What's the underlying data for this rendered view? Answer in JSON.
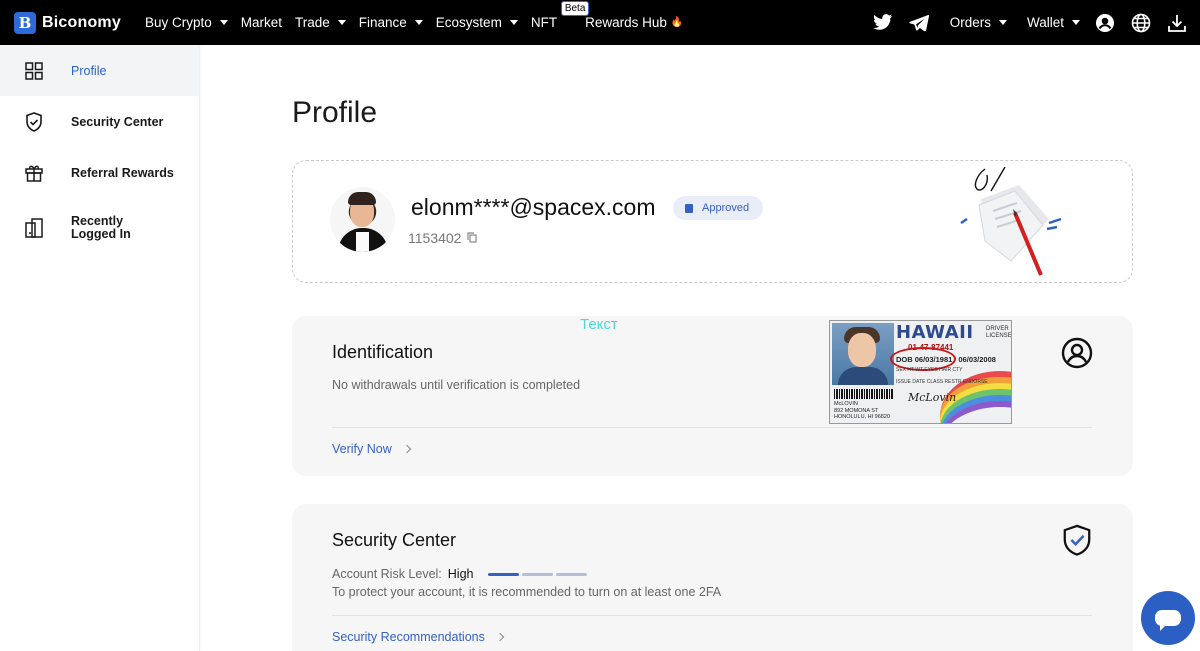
{
  "nav": {
    "logo_letter": "B",
    "logo_text": "Biconomy",
    "items": [
      {
        "label": "Buy Crypto",
        "dropdown": true
      },
      {
        "label": "Market",
        "dropdown": false
      },
      {
        "label": "Trade",
        "dropdown": true
      },
      {
        "label": "Finance",
        "dropdown": true
      },
      {
        "label": "Ecosystem",
        "dropdown": true
      },
      {
        "label": "NFT",
        "dropdown": false,
        "badge": "Beta"
      },
      {
        "label": "Rewards Hub",
        "dropdown": false
      }
    ],
    "right_items": [
      {
        "label": "Orders"
      },
      {
        "label": "Wallet"
      }
    ],
    "icons": [
      "twitter-icon",
      "telegram-icon",
      "user-icon",
      "globe-icon",
      "download-icon"
    ]
  },
  "sidebar": {
    "items": [
      {
        "label": "Profile",
        "icon": "dashboard-icon",
        "active": true
      },
      {
        "label": "Security Center",
        "icon": "shield-icon",
        "active": false
      },
      {
        "label": "Referral Rewards",
        "icon": "gift-icon",
        "active": false
      },
      {
        "label": "Recently Logged In",
        "icon": "device-icon",
        "active": false
      }
    ]
  },
  "page": {
    "title": "Profile"
  },
  "profile": {
    "email": "elonm****@spacex.com",
    "uid": "1153402",
    "status": "Approved"
  },
  "identification": {
    "overlay_text": "Текст",
    "title": "Identification",
    "subtitle": "No withdrawals until verification is completed",
    "link": "Verify Now",
    "license": {
      "state": "HAWAII",
      "sub_label": "DRIVER LICENSE",
      "number": "01-47-87441",
      "dob": "DOB 06/03/1981",
      "exp": "06/03/2008",
      "row1": "SEX HT WT EYES HAIR CTY",
      "row2": "ISSUE DATE CLASS RESTR ENDORSE",
      "name": "McLOVIN",
      "address1": "892 MOMONA ST",
      "address2": "HONOLULU, HI 96820",
      "signature": "McLovin"
    }
  },
  "security": {
    "title": "Security Center",
    "risk_label": "Account Risk Level:",
    "risk_value": "High",
    "risk_bars_total": 3,
    "risk_bars_filled": 1,
    "note": "To protect your account, it is recommended to turn on at least one 2FA",
    "link": "Security Recommendations"
  },
  "colors": {
    "accent": "#3560c4",
    "nav_bg": "#000000",
    "overlay": "#4fd6d9"
  }
}
